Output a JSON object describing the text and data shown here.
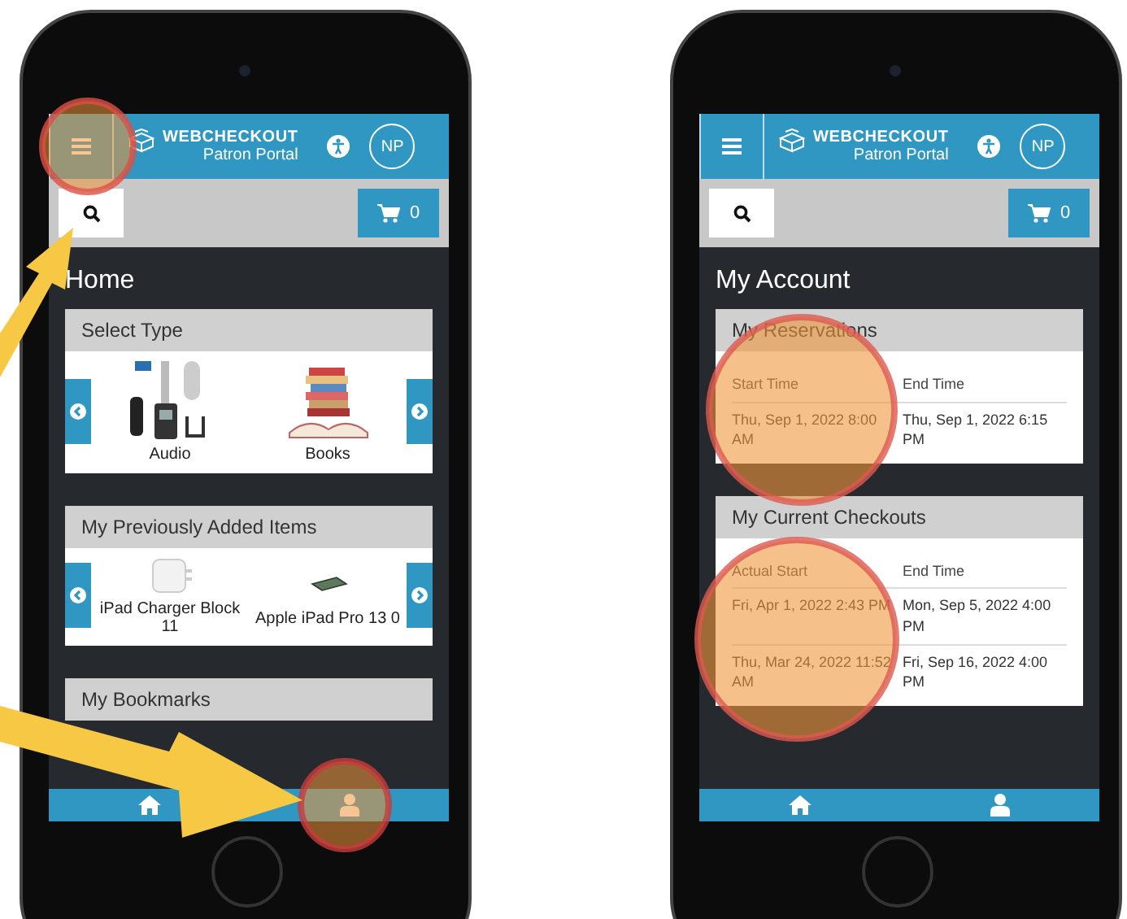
{
  "phones": [
    {
      "header": {
        "brand": "WEBCHECKOUT",
        "subtitle": "Patron Portal",
        "avatar": "NP"
      },
      "cart_count": "0",
      "page_title": "Home",
      "sections": [
        {
          "kind": "carousel",
          "title": "Select Type",
          "items": [
            {
              "kind": "audio",
              "label": "Audio"
            },
            {
              "kind": "books",
              "label": "Books"
            }
          ]
        },
        {
          "kind": "carousel",
          "title": "My Previously Added Items",
          "items": [
            {
              "kind": "charger",
              "label": "iPad Charger Block 11"
            },
            {
              "kind": "tablet",
              "label": "Apple iPad Pro 13 0"
            }
          ]
        },
        {
          "kind": "header_only",
          "title": "My Bookmarks"
        }
      ]
    },
    {
      "header": {
        "brand": "WEBCHECKOUT",
        "subtitle": "Patron Portal",
        "avatar": "NP"
      },
      "cart_count": "0",
      "page_title": "My Account",
      "sections": [
        {
          "kind": "table",
          "title": "My Reservations",
          "columns": [
            "Start Time",
            "End Time"
          ],
          "rows": [
            [
              "Thu, Sep 1, 2022 8:00 AM",
              "Thu, Sep 1, 2022 6:15 PM"
            ]
          ]
        },
        {
          "kind": "table",
          "title": "My Current Checkouts",
          "columns": [
            "Actual Start",
            "End Time"
          ],
          "rows": [
            [
              "Fri, Apr 1, 2022 2:43 PM",
              "Mon, Sep 5, 2022 4:00 PM"
            ],
            [
              "Thu, Mar 24, 2022 11:52 AM",
              "Fri, Sep 16, 2022 4:00 PM"
            ]
          ]
        }
      ]
    }
  ]
}
